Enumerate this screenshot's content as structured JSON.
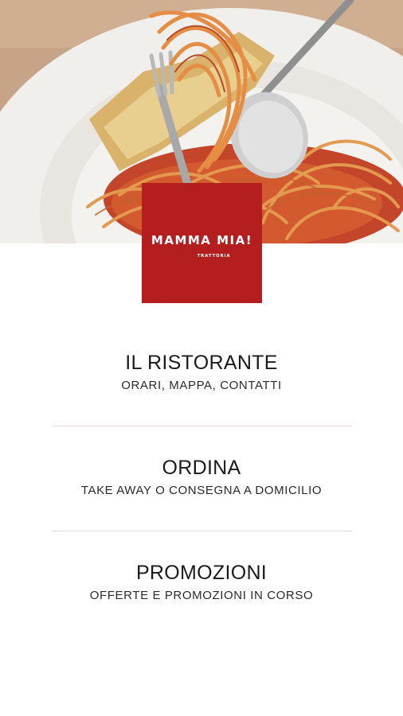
{
  "hero": {
    "image_desc_icon": "spaghetti-photo-icon"
  },
  "logo": {
    "name": "MAMMA MIA!",
    "subtitle": "TRATTORIA",
    "color": "#b51e1e"
  },
  "menu": {
    "items": [
      {
        "title": "IL RISTORANTE",
        "subtitle": "ORARI, MAPPA, CONTATTI"
      },
      {
        "title": "ORDINA",
        "subtitle": "TAKE AWAY O CONSEGNA A DOMICILIO"
      },
      {
        "title": "PROMOZIONI",
        "subtitle": "OFFERTE E PROMOZIONI IN CORSO"
      }
    ],
    "divider_color": "#ecd6d9"
  }
}
